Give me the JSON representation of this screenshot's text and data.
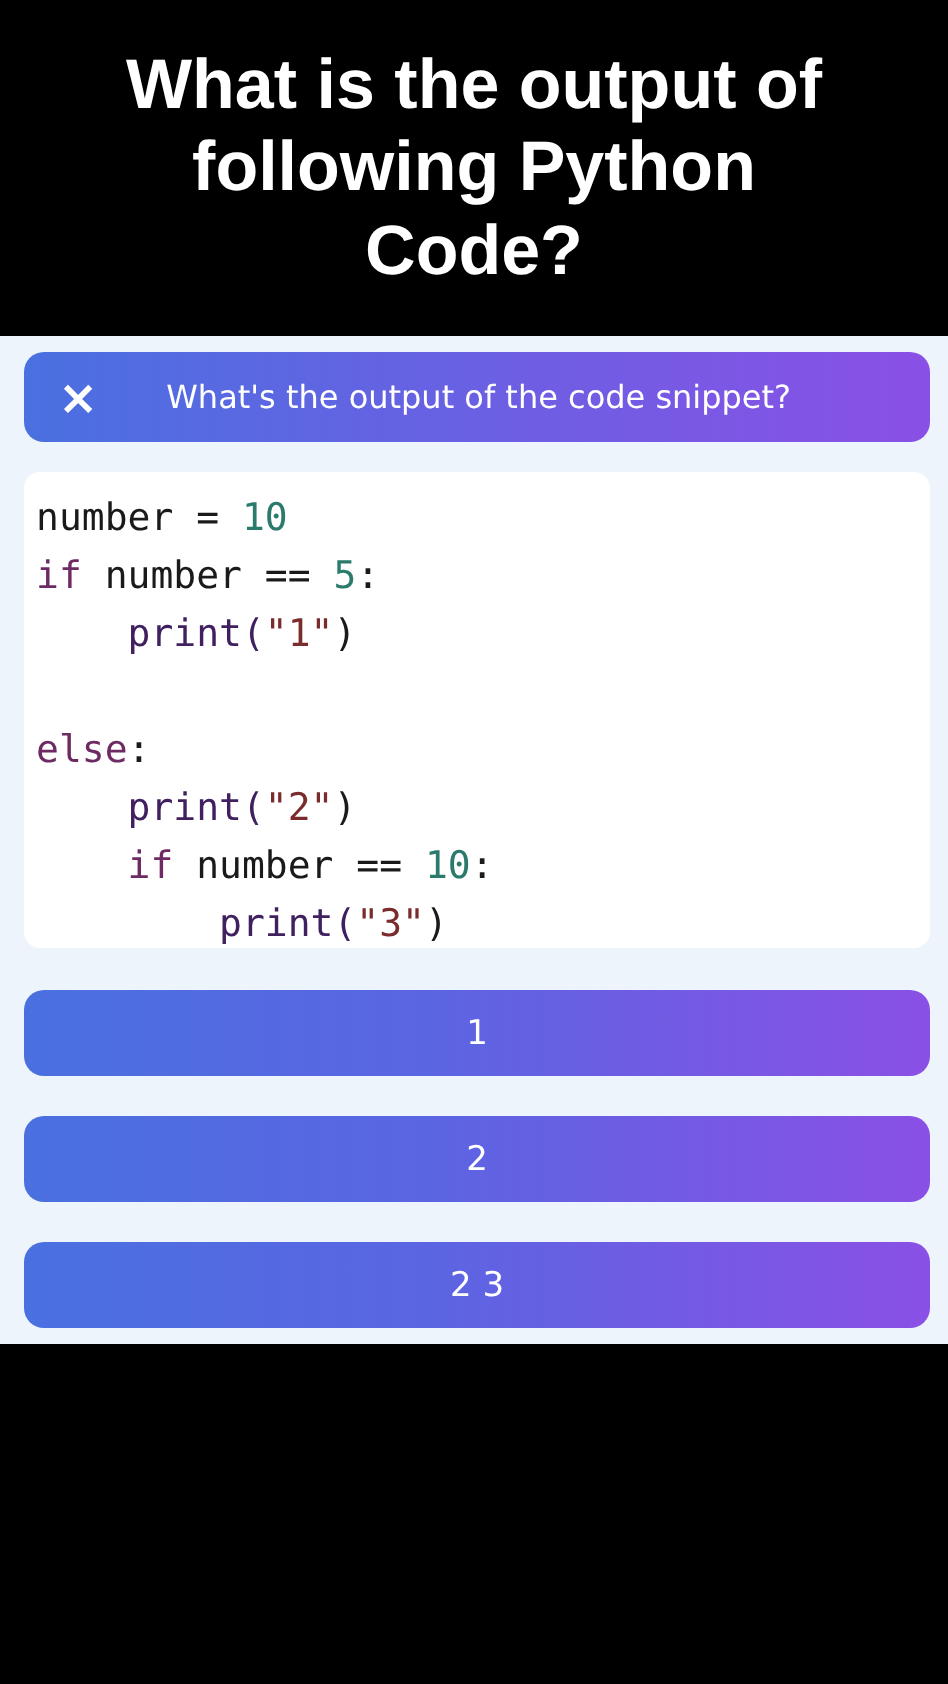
{
  "headline": "What is the output of following Python Code?",
  "question_bar": {
    "close": "×",
    "question": "What's the output of the code snippet?"
  },
  "code_lines": [
    {
      "blank_before": false,
      "tokens": [
        {
          "kind": "plain",
          "text": "number = "
        },
        {
          "kind": "number",
          "text": "10"
        }
      ]
    },
    {
      "blank_before": false,
      "tokens": [
        {
          "kind": "keyword",
          "text": "if"
        },
        {
          "kind": "plain",
          "text": " number == "
        },
        {
          "kind": "number",
          "text": "5"
        },
        {
          "kind": "plain",
          "text": ":"
        }
      ]
    },
    {
      "blank_before": false,
      "tokens": [
        {
          "kind": "func",
          "text": "    print("
        },
        {
          "kind": "string",
          "text": "\"1\""
        },
        {
          "kind": "plain",
          "text": ")"
        }
      ]
    },
    {
      "blank_before": true,
      "tokens": [
        {
          "kind": "keyword",
          "text": "else"
        },
        {
          "kind": "plain",
          "text": ":"
        }
      ]
    },
    {
      "blank_before": false,
      "tokens": [
        {
          "kind": "func",
          "text": "    print("
        },
        {
          "kind": "string",
          "text": "\"2\""
        },
        {
          "kind": "plain",
          "text": ")"
        }
      ]
    },
    {
      "blank_before": false,
      "tokens": [
        {
          "kind": "keyword",
          "text": "    if"
        },
        {
          "kind": "plain",
          "text": " number == "
        },
        {
          "kind": "number",
          "text": "10"
        },
        {
          "kind": "plain",
          "text": ":"
        }
      ]
    },
    {
      "blank_before": false,
      "tokens": [
        {
          "kind": "func",
          "text": "        print("
        },
        {
          "kind": "string",
          "text": "\"3\""
        },
        {
          "kind": "plain",
          "text": ")"
        }
      ]
    }
  ],
  "answers": [
    "1",
    "2",
    "2 3"
  ]
}
